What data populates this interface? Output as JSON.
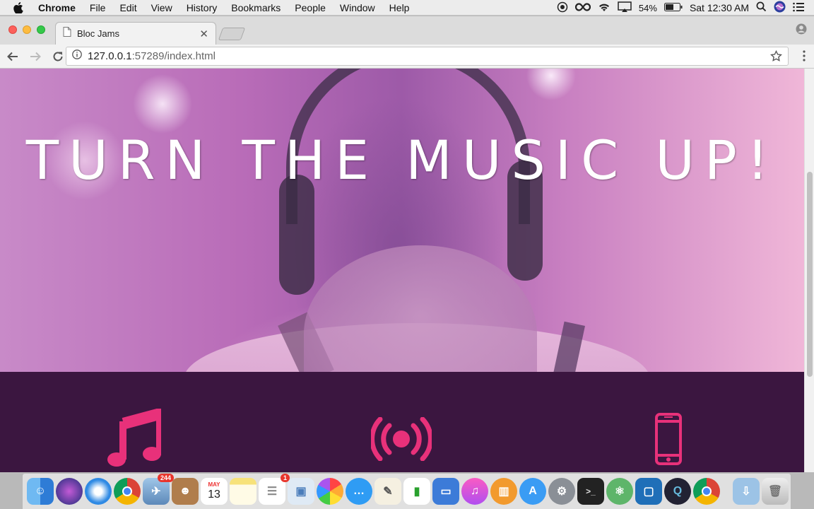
{
  "menubar": {
    "app_name": "Chrome",
    "items": [
      "File",
      "Edit",
      "View",
      "History",
      "Bookmarks",
      "People",
      "Window",
      "Help"
    ],
    "battery_percent": "54%",
    "clock": "Sat 12:30 AM"
  },
  "browser": {
    "tab_title": "Bloc Jams",
    "url_host": "127.0.0.1",
    "url_rest": ":57289/index.html"
  },
  "page": {
    "hero_title": "TURN THE MUSIC UP!",
    "accent_color": "#e8317a",
    "hero_tint": "#b86bb8",
    "features_bg": "#3b1640",
    "feature_icons": [
      "music-note-icon",
      "broadcast-icon",
      "mobile-phone-icon"
    ]
  },
  "dock": {
    "icons": [
      "Finder",
      "Siri",
      "Safari",
      "Chrome",
      "Mail",
      "Contacts",
      "Calendar",
      "Notes",
      "Reminders",
      "Preview",
      "Photos",
      "Messages",
      "TextEdit",
      "Numbers",
      "Keynote",
      "iTunes",
      "iBooks",
      "App Store",
      "System Preferences",
      "Terminal",
      "Atom",
      "Code",
      "QuickTime",
      "Chrome",
      "Downloads",
      "Trash"
    ],
    "mail_badge": "244",
    "reminders_badge": "1",
    "calendar_month": "MAY",
    "calendar_day": "13"
  }
}
